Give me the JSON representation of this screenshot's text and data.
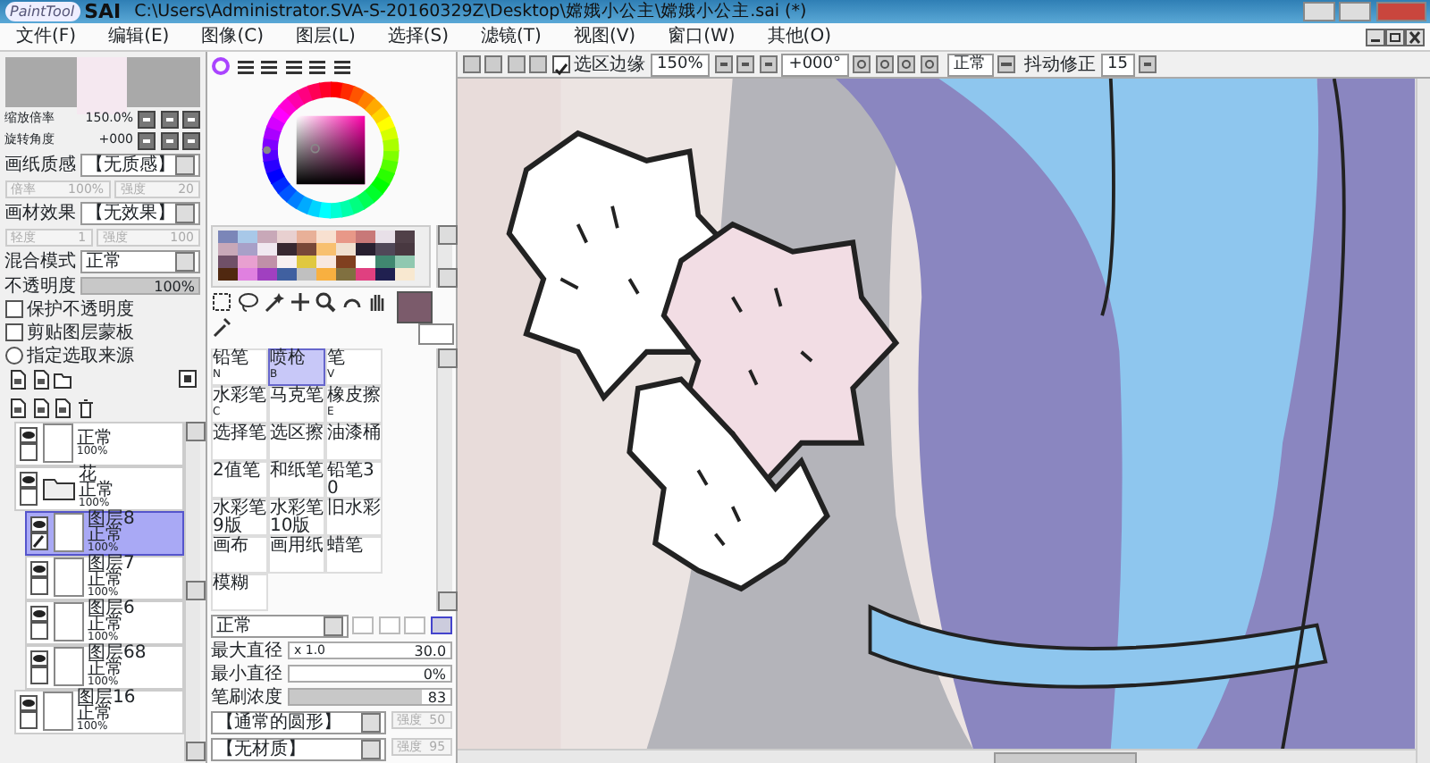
{
  "window": {
    "logo": "PaintTool",
    "logo_sai": "SAI",
    "title": "C:\\Users\\Administrator.SVA-S-20160329Z\\Desktop\\嫦娥小公主\\嫦娥小公主.sai (*)"
  },
  "menu": [
    "文件(F)",
    "编辑(E)",
    "图像(C)",
    "图层(L)",
    "选择(S)",
    "滤镜(T)",
    "视图(V)",
    "窗口(W)",
    "其他(O)"
  ],
  "navigator": {
    "zoom_label": "缩放倍率",
    "zoom_value": "150.0%",
    "rotate_label": "旋转角度",
    "rotate_value": "+000"
  },
  "paper": {
    "texture_label": "画纸质感",
    "texture_value": "【无质感】",
    "effect_label": "画材效果",
    "effect_value": "【无效果】",
    "sliders": [
      {
        "label": "倍率",
        "value": "100%",
        "disabled": true
      },
      {
        "label": "强度",
        "value": "20",
        "disabled": true
      },
      {
        "label": "轻度",
        "value": "1",
        "disabled": true
      },
      {
        "label": "强度",
        "value": "100",
        "disabled": true
      }
    ]
  },
  "layer_props": {
    "blend_label": "混合模式",
    "blend_value": "正常",
    "opacity": {
      "label": "不透明度",
      "value": "100%",
      "level": 1
    },
    "options": [
      {
        "kind": "checkbox",
        "label": "保护不透明度",
        "checked": false
      },
      {
        "kind": "checkbox",
        "label": "剪贴图层蒙板",
        "checked": false
      },
      {
        "kind": "radio",
        "label": "指定选取来源",
        "checked": false
      }
    ]
  },
  "layers": [
    {
      "kind": "layer",
      "mode": "正常",
      "opacity": "100%",
      "selected": false
    },
    {
      "kind": "folder",
      "name": "花",
      "mode": "正常",
      "opacity": "100%",
      "selected": false,
      "children": [
        {
          "kind": "layer",
          "name": "图层8",
          "mode": "正常",
          "opacity": "100%",
          "selected": true
        },
        {
          "kind": "layer",
          "name": "图层7",
          "mode": "正常",
          "opacity": "100%",
          "selected": false
        },
        {
          "kind": "layer",
          "name": "图层6",
          "mode": "正常",
          "opacity": "100%",
          "selected": false
        },
        {
          "kind": "layer",
          "name": "图层68",
          "mode": "正常",
          "opacity": "100%",
          "selected": false
        }
      ]
    },
    {
      "kind": "layer",
      "name": "图层16",
      "mode": "正常",
      "opacity": "100%",
      "selected": false
    }
  ],
  "swatches": [
    {
      "color": "#7b86b8"
    },
    {
      "color": "#a8c8e8"
    },
    {
      "color": "#c8a8b8"
    },
    {
      "color": "#e8d0d0"
    },
    {
      "color": "#e8b098"
    },
    {
      "color": "#f8e0d0"
    },
    {
      "color": "#e89888"
    },
    {
      "color": "#c87878"
    },
    {
      "color": "#e8e0e8"
    },
    {
      "color": "#504048"
    },
    {
      "color": "#c8a8b8"
    },
    {
      "color": "#a8a0c8"
    },
    {
      "color": "#f0e8f0"
    },
    {
      "color": "#382830"
    },
    {
      "color": "#784838"
    },
    {
      "color": "#f8c070"
    },
    {
      "color": "#f0e0d0"
    },
    {
      "color": "#282030"
    },
    {
      "color": "#504858"
    },
    {
      "color": "#483840"
    },
    {
      "color": "#705068"
    },
    {
      "color": "#e8a0d0"
    },
    {
      "color": "#c090a8"
    },
    {
      "color": "#f8f0f0"
    },
    {
      "color": "#e0c840"
    },
    {
      "color": "#f8e8e0"
    },
    {
      "color": "#804020"
    },
    {
      "color": "#ffffff"
    },
    {
      "color": "#408870"
    },
    {
      "color": "#90c8b0"
    },
    {
      "color": "#502810"
    },
    {
      "color": "#e080e0"
    },
    {
      "color": "#a040c0"
    },
    {
      "color": "#4060a0"
    },
    {
      "color": "#c0c0c0"
    },
    {
      "color": "#f8b040"
    },
    {
      "color": "#807040"
    },
    {
      "color": "#e04080"
    },
    {
      "color": "#202050"
    },
    {
      "color": "#f8e8d0"
    }
  ],
  "current_color": {
    "color": "#7b5b6b"
  },
  "tools": [
    {
      "name": "铅笔",
      "key": "N",
      "selected": false
    },
    {
      "name": "喷枪",
      "key": "B",
      "selected": true
    },
    {
      "name": "笔",
      "key": "V",
      "selected": false
    },
    {
      "name": "水彩笔",
      "key": "C",
      "selected": false
    },
    {
      "name": "马克笔",
      "selected": false
    },
    {
      "name": "橡皮擦",
      "key": "E",
      "selected": false
    },
    {
      "name": "选择笔",
      "selected": false
    },
    {
      "name": "选区擦",
      "selected": false
    },
    {
      "name": "油漆桶",
      "selected": false
    },
    {
      "name": "2值笔",
      "selected": false
    },
    {
      "name": "和纸笔",
      "selected": false
    },
    {
      "name": "铅笔30",
      "selected": false
    },
    {
      "name": "水彩笔9版",
      "selected": false
    },
    {
      "name": "水彩笔10版",
      "selected": false
    },
    {
      "name": "旧水彩",
      "selected": false
    },
    {
      "name": "画布",
      "selected": false
    },
    {
      "name": "画用纸",
      "selected": false
    },
    {
      "name": "蜡笔",
      "selected": false
    },
    {
      "name": "模糊",
      "selected": false
    }
  ],
  "brush": {
    "blend": "正常",
    "shapes": [
      {
        "selected": false
      },
      {
        "selected": false
      },
      {
        "selected": false
      },
      {
        "selected": true
      }
    ],
    "max_size": {
      "label": "最大直径",
      "factor": "x 1.0",
      "value": "30.0"
    },
    "min_size": {
      "label": "最小直径",
      "value": "0%"
    },
    "density": {
      "label": "笔刷浓度",
      "value": "83",
      "level": 0.83
    },
    "shape": {
      "value": "【通常的圆形】",
      "strength_label": "强度",
      "strength_value": "50",
      "disabled": true
    },
    "texture": {
      "value": "【无材质】",
      "strength_label": "强度",
      "strength_value": "95",
      "disabled": true
    }
  },
  "canvas_toolbar": {
    "selection_edge": {
      "label": "选区边缘",
      "checked": true
    },
    "zoom": "150%",
    "rotation": "+000°",
    "blend": "正常",
    "stabilizer_label": "抖动修正",
    "stabilizer_value": "15"
  }
}
